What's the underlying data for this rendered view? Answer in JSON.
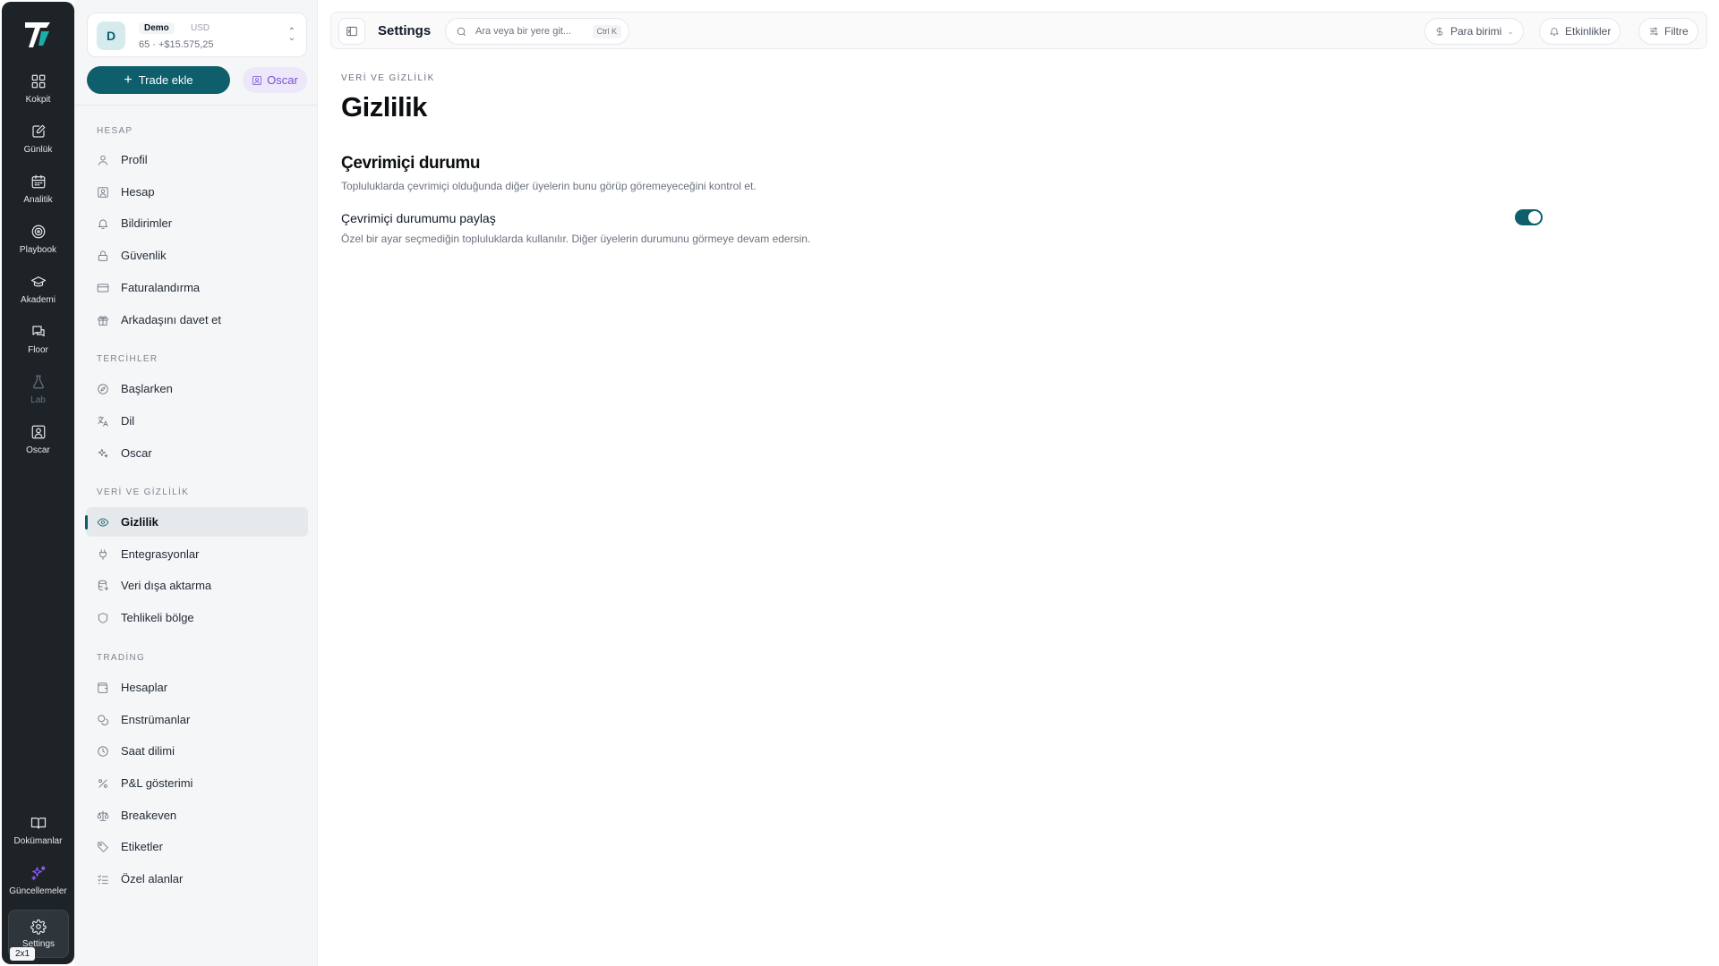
{
  "rail": {
    "items": [
      {
        "label": "Kokpit"
      },
      {
        "label": "Günlük"
      },
      {
        "label": "Analitik"
      },
      {
        "label": "Playbook"
      },
      {
        "label": "Akademi"
      },
      {
        "label": "Floor"
      },
      {
        "label": "Lab"
      },
      {
        "label": "Oscar"
      }
    ],
    "bottom": [
      {
        "label": "Dokümanlar"
      },
      {
        "label": "Güncellemeler"
      }
    ],
    "settings_label": "Settings",
    "zoom_badge": "2x1"
  },
  "account": {
    "avatar_letter": "D",
    "mode": "Demo",
    "currency": "USD",
    "summary": "65 · +$15.575,25"
  },
  "actions": {
    "trade_label": "Trade ekle",
    "oscar_label": "Oscar"
  },
  "sidebar": {
    "sections": [
      {
        "title": "HESAP",
        "items": [
          "Profil",
          "Hesap",
          "Bildirimler",
          "Güvenlik",
          "Faturalandırma",
          "Arkadaşını davet et"
        ]
      },
      {
        "title": "TERCİHLER",
        "items": [
          "Başlarken",
          "Dil",
          "Oscar"
        ]
      },
      {
        "title": "VERİ VE GİZLİLİK",
        "items": [
          "Gizlilik",
          "Entegrasyonlar",
          "Veri dışa aktarma",
          "Tehlikeli bölge"
        ]
      },
      {
        "title": "TRADİNG",
        "items": [
          "Hesaplar",
          "Enstrümanlar",
          "Saat dilimi",
          "P&L gösterimi",
          "Breakeven",
          "Etiketler",
          "Özel alanlar"
        ]
      }
    ],
    "active_item": "Gizlilik"
  },
  "topbar": {
    "title": "Settings",
    "search_placeholder": "Ara veya bir yere git...",
    "search_shortcut": "Ctrl K",
    "currency_button": "Para birimi",
    "events_button": "Etkinlikler",
    "filter_button": "Filtre"
  },
  "page": {
    "breadcrumb": "VERİ VE GİZLİLİK",
    "title": "Gizlilik",
    "section_title": "Çevrimiçi durumu",
    "section_desc": "Topluluklarda çevrimiçi olduğunda diğer üyelerin bunu görüp göremeyeceğini kontrol et.",
    "setting_label": "Çevrimiçi durumumu paylaş",
    "setting_desc": "Özel bir ayar seçmediğin topluluklarda kullanılır. Diğer üyelerin durumunu görmeye devam edersin.",
    "setting_enabled": true
  },
  "colors": {
    "accent": "#0e5f6b",
    "rail_bg": "#1d2327",
    "oscar_purple": "#7c4fd1"
  }
}
